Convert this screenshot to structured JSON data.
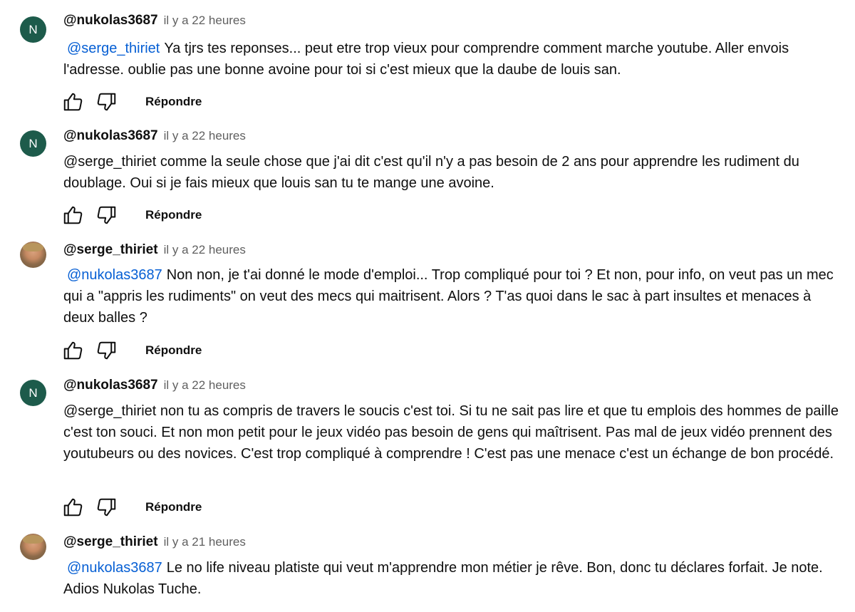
{
  "comments": [
    {
      "author": "@nukolas3687",
      "time": "il y a 22 heures",
      "avatar_letter": "N",
      "mention": "@serge_thiriet",
      "text": "Ya tjrs tes reponses... peut etre trop vieux pour comprendre comment marche youtube. Aller envois l'adresse. oublie pas une bonne avoine pour toi si c'est mieux que la daube de louis san.",
      "reply_label": "Répondre"
    },
    {
      "author": "@nukolas3687",
      "time": "il y a 22 heures",
      "avatar_letter": "N",
      "mention": "",
      "text": "@serge_thiriet  comme la seule chose que j'ai dit c'est qu'il n'y a pas besoin de 2 ans pour apprendre les rudiment du doublage. Oui si je fais mieux que louis san tu te mange une avoine.",
      "reply_label": "Répondre"
    },
    {
      "author": "@serge_thiriet",
      "time": "il y a 22 heures",
      "avatar_letter": "",
      "mention": "@nukolas3687",
      "text": "Non non, je t'ai donné le mode d'emploi... Trop compliqué pour toi ? Et non, pour info, on veut pas un mec qui a \"appris les rudiments\" on veut des mecs qui maitrisent. Alors ? T'as quoi dans le sac à part insultes et menaces à deux balles ?",
      "reply_label": "Répondre"
    },
    {
      "author": "@nukolas3687",
      "time": "il y a 22 heures",
      "avatar_letter": "N",
      "mention": "",
      "text": "@serge_thiriet  non tu as compris de travers le soucis c'est toi. Si tu ne sait pas lire et que tu emplois des hommes de paille c'est ton souci. Et non mon petit pour le jeux vidéo pas besoin de gens qui maîtrisent. Pas mal de jeux vidéo prennent des youtubeurs ou des novices. C'est trop compliqué à comprendre ! C'est pas une menace c'est un échange de bon procédé.",
      "reply_label": "Répondre"
    },
    {
      "author": "@serge_thiriet",
      "time": "il y a 21 heures",
      "avatar_letter": "",
      "mention": "@nukolas3687",
      "text": "Le no life niveau platiste qui veut m'apprendre mon métier je rêve. Bon, donc tu déclares forfait. Je note. Adios Nukolas Tuche.",
      "reply_label": ""
    }
  ],
  "colors": {
    "mention": "#065fd4",
    "avatar_letter_bg": "#1d5b4b",
    "meta_text": "#606060"
  },
  "icons": {
    "like": "thumb-up-icon",
    "dislike": "thumb-down-icon"
  }
}
